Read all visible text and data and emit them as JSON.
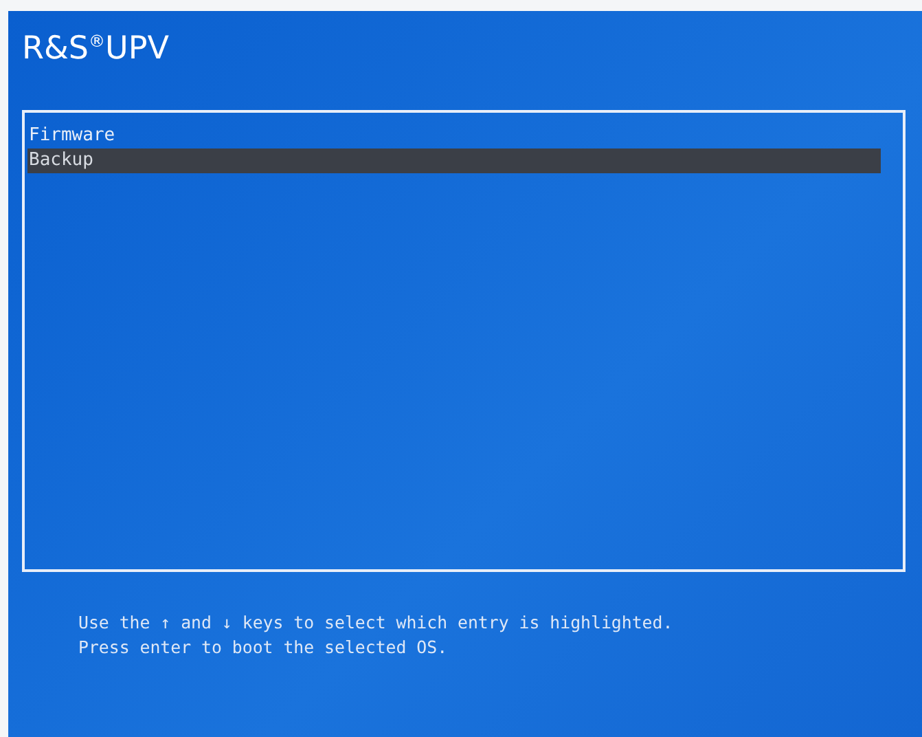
{
  "title": "R&S$^{®}$UPV",
  "menu": {
    "items": [
      {
        "label": "Firmware",
        "selected": false
      },
      {
        "label": "Backup",
        "selected": true
      }
    ]
  },
  "help": [
    "Use the ↑ and ↓ keys to select which entry is highlighted.",
    "Press enter to boot the selected OS."
  ]
}
